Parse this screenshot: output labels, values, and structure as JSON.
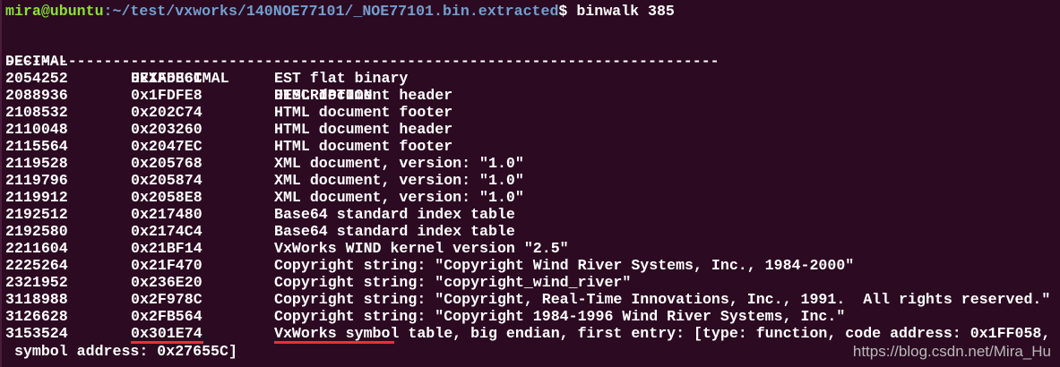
{
  "prompt": {
    "user_host": "mira@ubuntu",
    "path": ":~/test/vxworks/140NOE77101/_NOE77101.bin.extracted",
    "symbol": "$ ",
    "command": "binwalk 385"
  },
  "headers": [
    "DECIMAL",
    "HEXADECIMAL",
    "DESCRIPTION"
  ],
  "separator": "--------------------------------------------------------------------------------",
  "rows": [
    [
      "2054252",
      "0x1F586C",
      "EST flat binary"
    ],
    [
      "2088936",
      "0x1FDFE8",
      "HTML document header"
    ],
    [
      "2108532",
      "0x202C74",
      "HTML document footer"
    ],
    [
      "2110048",
      "0x203260",
      "HTML document header"
    ],
    [
      "2115564",
      "0x2047EC",
      "HTML document footer"
    ],
    [
      "2119528",
      "0x205768",
      "XML document, version: \"1.0\""
    ],
    [
      "2119796",
      "0x205874",
      "XML document, version: \"1.0\""
    ],
    [
      "2119912",
      "0x2058E8",
      "XML document, version: \"1.0\""
    ],
    [
      "2192512",
      "0x217480",
      "Base64 standard index table"
    ],
    [
      "2192580",
      "0x2174C4",
      "Base64 standard index table"
    ],
    [
      "2211604",
      "0x21BF14",
      "VxWorks WIND kernel version \"2.5\""
    ],
    [
      "2225264",
      "0x21F470",
      "Copyright string: \"Copyright Wind River Systems, Inc., 1984-2000\""
    ],
    [
      "2321952",
      "0x236E20",
      "Copyright string: \"copyright_wind_river\""
    ],
    [
      "3118988",
      "0x2F978C",
      "Copyright string: \"Copyright, Real-Time Innovations, Inc., 1991.  All rights reserved.\""
    ],
    [
      "3126628",
      "0x2FB564",
      "Copyright string: \"Copyright 1984-1996 Wind River Systems, Inc.\""
    ],
    [
      "3153524",
      "0x301E74",
      "VxWorks symbol table, big endian, first entry: [type: function, code address: 0x1FF058,"
    ]
  ],
  "wrap_line": " symbol address: 0x27655C]",
  "watermark": "https://blog.csdn.net/Mira_Hu",
  "colors": {
    "background": "#2c0a22",
    "user": "#8ae234",
    "path": "#729fcf",
    "underline": "#e8303a"
  }
}
